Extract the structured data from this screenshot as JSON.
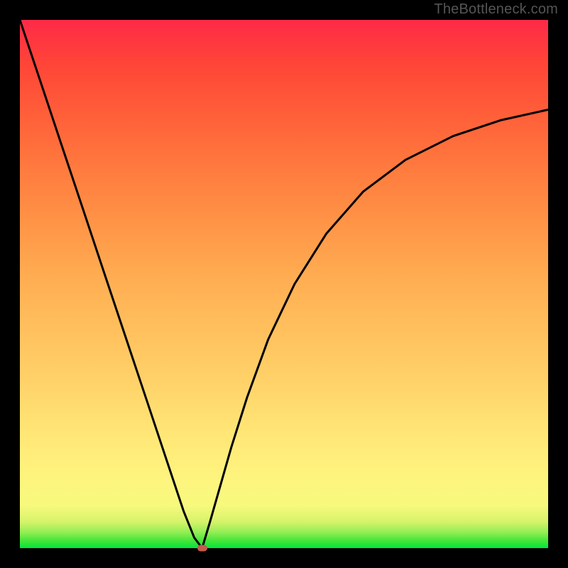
{
  "watermark": "TheBottleneck.com",
  "chart_data": {
    "type": "line",
    "title": "",
    "xlabel": "",
    "ylabel": "",
    "xlim": [
      0,
      1
    ],
    "ylim": [
      0,
      1
    ],
    "series": [
      {
        "name": "left-branch",
        "x": [
          0.0,
          0.04,
          0.08,
          0.12,
          0.16,
          0.2,
          0.24,
          0.28,
          0.31,
          0.33,
          0.345
        ],
        "values": [
          1.0,
          0.88,
          0.76,
          0.64,
          0.52,
          0.4,
          0.28,
          0.16,
          0.07,
          0.02,
          0.0
        ]
      },
      {
        "name": "right-branch",
        "x": [
          0.345,
          0.36,
          0.38,
          0.4,
          0.43,
          0.47,
          0.52,
          0.58,
          0.65,
          0.73,
          0.82,
          0.91,
          1.0
        ],
        "values": [
          0.0,
          0.05,
          0.12,
          0.19,
          0.285,
          0.395,
          0.5,
          0.595,
          0.675,
          0.735,
          0.78,
          0.81,
          0.83
        ]
      }
    ],
    "marker": {
      "x": 0.345,
      "y": 0.0,
      "color": "#c75a4d"
    },
    "grid": false,
    "legend": false
  },
  "colors": {
    "curve": "#000000",
    "background_top": "#ff2a47",
    "background_bottom": "#00e63b",
    "frame": "#000000"
  }
}
